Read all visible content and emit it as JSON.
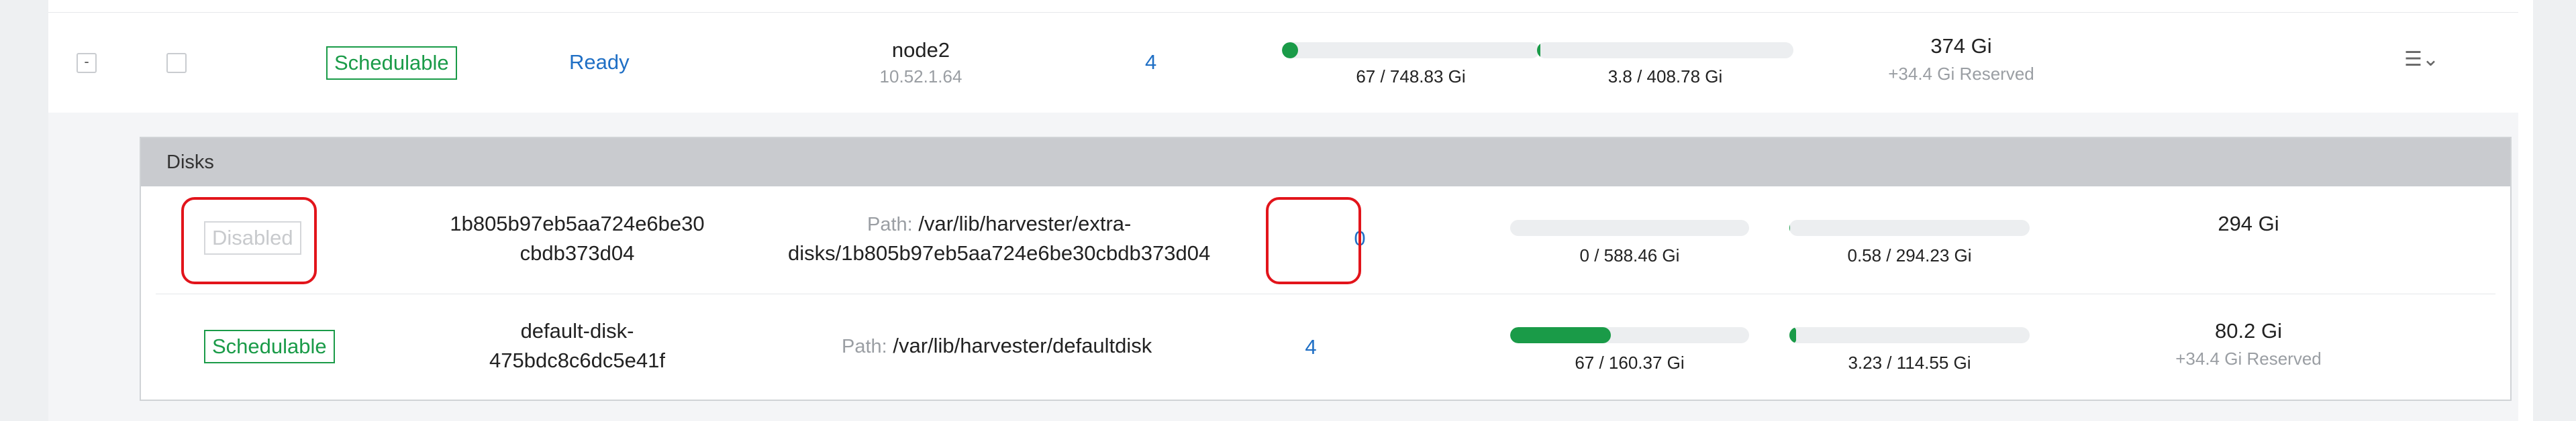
{
  "node_row": {
    "expander": "-",
    "status": "Schedulable",
    "state": "Ready",
    "name": "node2",
    "ip": "10.52.1.64",
    "disk_count": "4",
    "storage_scheduled": {
      "label": "67 / 748.83 Gi",
      "fraction": 0.04
    },
    "storage_used": {
      "label": "3.8 / 408.78 Gi",
      "fraction": 0.01
    },
    "allocatable": "374 Gi",
    "reserved": "+34.4 Gi Reserved",
    "actions_icon": "list-chevron-down-icon"
  },
  "disks": {
    "title": "Disks",
    "rows": [
      {
        "status": "Disabled",
        "name_line1": "1b805b97eb5aa724e6be30",
        "name_line2": "cbdb373d04",
        "path_label": "Path:",
        "path_line1": "/var/lib/harvester/extra-",
        "path_line2": "disks/1b805b97eb5aa724e6be30cbdb373d04",
        "replicas": "0",
        "scheduled": {
          "label": "0 / 588.46 Gi",
          "fraction": 0.0
        },
        "used": {
          "label": "0.58 / 294.23 Gi",
          "fraction": 0.002
        },
        "allocatable": "294 Gi",
        "reserved": ""
      },
      {
        "status": "Schedulable",
        "name_line1": "default-disk-",
        "name_line2": "475bdc8c6dc5e41f",
        "path_label": "Path:",
        "path_line1": "/var/lib/harvester/defaultdisk",
        "path_line2": "",
        "replicas": "4",
        "scheduled": {
          "label": "67 / 160.37 Gi",
          "fraction": 0.42
        },
        "used": {
          "label": "3.23 / 114.55 Gi",
          "fraction": 0.028
        },
        "allocatable": "80.2 Gi",
        "reserved": "+34.4 Gi Reserved"
      }
    ]
  },
  "colors": {
    "accent_green": "#1a9b48",
    "link_blue": "#1f6fc5",
    "highlight_red": "#e2141b"
  }
}
